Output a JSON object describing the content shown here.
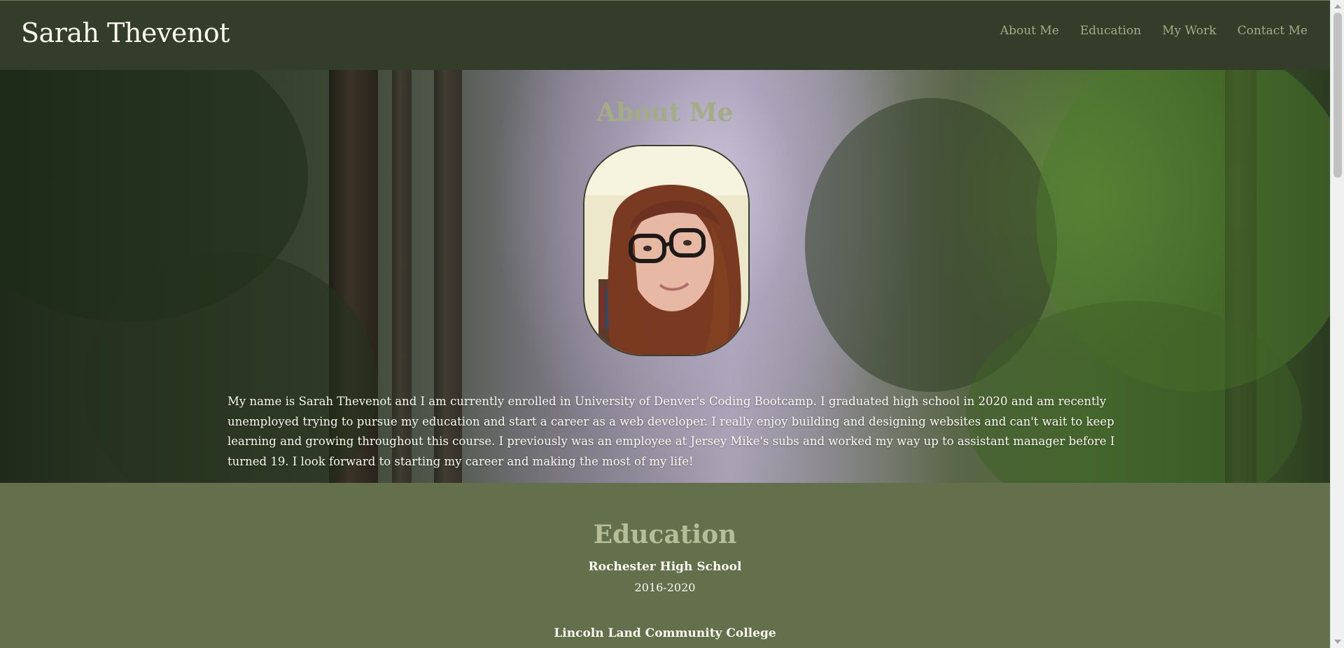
{
  "header": {
    "site_title": "Sarah Thevenot",
    "nav": [
      {
        "label": "About Me"
      },
      {
        "label": "Education"
      },
      {
        "label": "My Work"
      },
      {
        "label": "Contact Me"
      }
    ]
  },
  "about": {
    "heading": "About Me",
    "portrait_icon": "profile-photo",
    "paragraph": "My name is Sarah Thevenot and I am currently enrolled in University of Denver's Coding Bootcamp. I graduated high school in 2020 and am recently unemployed trying to pursue my education and start a career as a web developer. I really enjoy building and designing websites and can't wait to keep learning and growing throughout this course. I previously was an employee at Jersey Mike's subs and worked my way up to assistant manager before I turned 19. I look forward to starting my career and making the most of my life!"
  },
  "education": {
    "heading": "Education",
    "schools": [
      {
        "name": "Rochester High School",
        "years": "2016-2020"
      },
      {
        "name": "Lincoln Land Community College"
      }
    ]
  },
  "colors": {
    "header_bg": "#333d29",
    "nav_text": "#a4ac86",
    "section_bg": "#646f4b",
    "heading_text": "#b6be98"
  }
}
